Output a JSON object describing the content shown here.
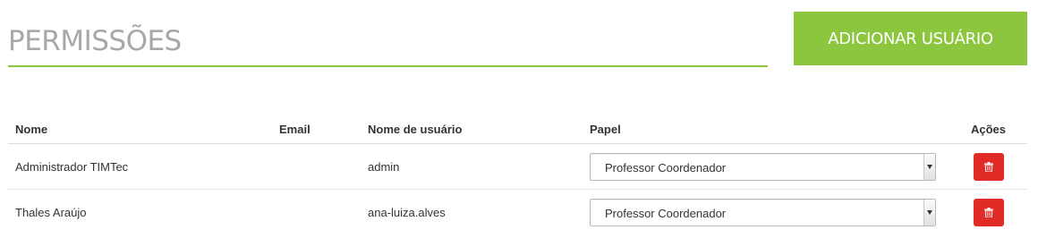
{
  "header": {
    "title": "PERMISSÕES",
    "add_user_label": "ADICIONAR USUÁRIO",
    "accent_color": "#8cc63f"
  },
  "table": {
    "columns": {
      "name": "Nome",
      "email": "Email",
      "username": "Nome de usuário",
      "role": "Papel",
      "actions": "Ações"
    },
    "rows": [
      {
        "name": "Administrador TIMTec",
        "email": "",
        "username": "admin",
        "role": "Professor Coordenador",
        "action_icon": "trash-icon"
      },
      {
        "name": "Thales Araújo",
        "email": "",
        "username": "ana-luiza.alves",
        "role": "Professor Coordenador",
        "action_icon": "trash-icon"
      }
    ],
    "delete_color": "#e02b27"
  }
}
